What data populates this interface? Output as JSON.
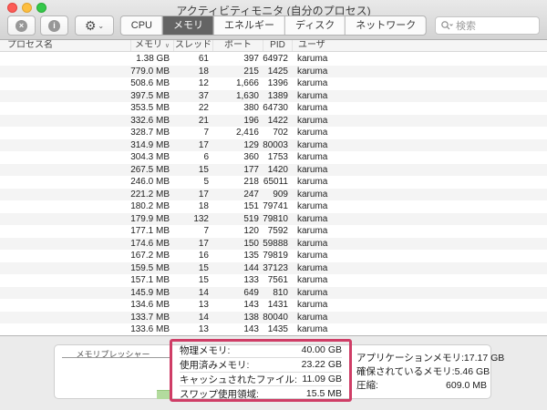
{
  "window": {
    "title": "アクティビティモニタ (自分のプロセス)"
  },
  "toolbar": {
    "quit_icon_label": "×",
    "info_icon_label": "i",
    "gear_glyph": "⚙",
    "gear_chevron": "⌄",
    "tabs": [
      {
        "label": "CPU",
        "selected": false
      },
      {
        "label": "メモリ",
        "selected": true
      },
      {
        "label": "エネルギー",
        "selected": false
      },
      {
        "label": "ディスク",
        "selected": false
      },
      {
        "label": "ネットワーク",
        "selected": false
      }
    ],
    "search": {
      "placeholder": "検索"
    }
  },
  "table": {
    "columns": [
      "プロセス名",
      "メモリ",
      "スレッド",
      "ポート",
      "PID",
      "ユーザ"
    ],
    "sort": {
      "column": "メモリ",
      "direction": "desc",
      "indicator": "∨"
    },
    "rows": [
      [
        "1.38 GB",
        "61",
        "397",
        "64972",
        "karuma"
      ],
      [
        "779.0 MB",
        "18",
        "215",
        "1425",
        "karuma"
      ],
      [
        "508.6 MB",
        "12",
        "1,666",
        "1396",
        "karuma"
      ],
      [
        "397.5 MB",
        "37",
        "1,630",
        "1389",
        "karuma"
      ],
      [
        "353.5 MB",
        "22",
        "380",
        "64730",
        "karuma"
      ],
      [
        "332.6 MB",
        "21",
        "196",
        "1422",
        "karuma"
      ],
      [
        "328.7 MB",
        "7",
        "2,416",
        "702",
        "karuma"
      ],
      [
        "314.9 MB",
        "17",
        "129",
        "80003",
        "karuma"
      ],
      [
        "304.3 MB",
        "6",
        "360",
        "1753",
        "karuma"
      ],
      [
        "267.5 MB",
        "15",
        "177",
        "1420",
        "karuma"
      ],
      [
        "246.0 MB",
        "5",
        "218",
        "65011",
        "karuma"
      ],
      [
        "221.2 MB",
        "17",
        "247",
        "909",
        "karuma"
      ],
      [
        "180.2 MB",
        "18",
        "151",
        "79741",
        "karuma"
      ],
      [
        "179.9 MB",
        "132",
        "519",
        "79810",
        "karuma"
      ],
      [
        "177.1 MB",
        "7",
        "120",
        "7592",
        "karuma"
      ],
      [
        "174.6 MB",
        "17",
        "150",
        "59888",
        "karuma"
      ],
      [
        "167.2 MB",
        "16",
        "135",
        "79819",
        "karuma"
      ],
      [
        "159.5 MB",
        "15",
        "144",
        "37123",
        "karuma"
      ],
      [
        "157.1 MB",
        "15",
        "133",
        "7561",
        "karuma"
      ],
      [
        "145.9 MB",
        "14",
        "649",
        "810",
        "karuma"
      ],
      [
        "134.6 MB",
        "13",
        "143",
        "1431",
        "karuma"
      ],
      [
        "133.7 MB",
        "14",
        "138",
        "80040",
        "karuma"
      ],
      [
        "133.6 MB",
        "13",
        "143",
        "1435",
        "karuma"
      ]
    ]
  },
  "footer": {
    "memory_pressure_label": "メモリプレッシャー",
    "stats_left": [
      {
        "label": "物理メモリ:",
        "value": "40.00 GB"
      },
      {
        "label": "使用済みメモリ:",
        "value": "23.22 GB"
      },
      {
        "label": "キャッシュされたファイル:",
        "value": "11.09 GB"
      },
      {
        "label": "スワップ使用領域:",
        "value": "15.5 MB"
      }
    ],
    "stats_right": [
      {
        "label": "アプリケーションメモリ:",
        "value": "17.17 GB"
      },
      {
        "label": "確保されているメモリ:",
        "value": "5.46 GB"
      },
      {
        "label": "圧縮:",
        "value": "609.0 MB"
      }
    ],
    "annotation_color": "#cf3d66"
  }
}
